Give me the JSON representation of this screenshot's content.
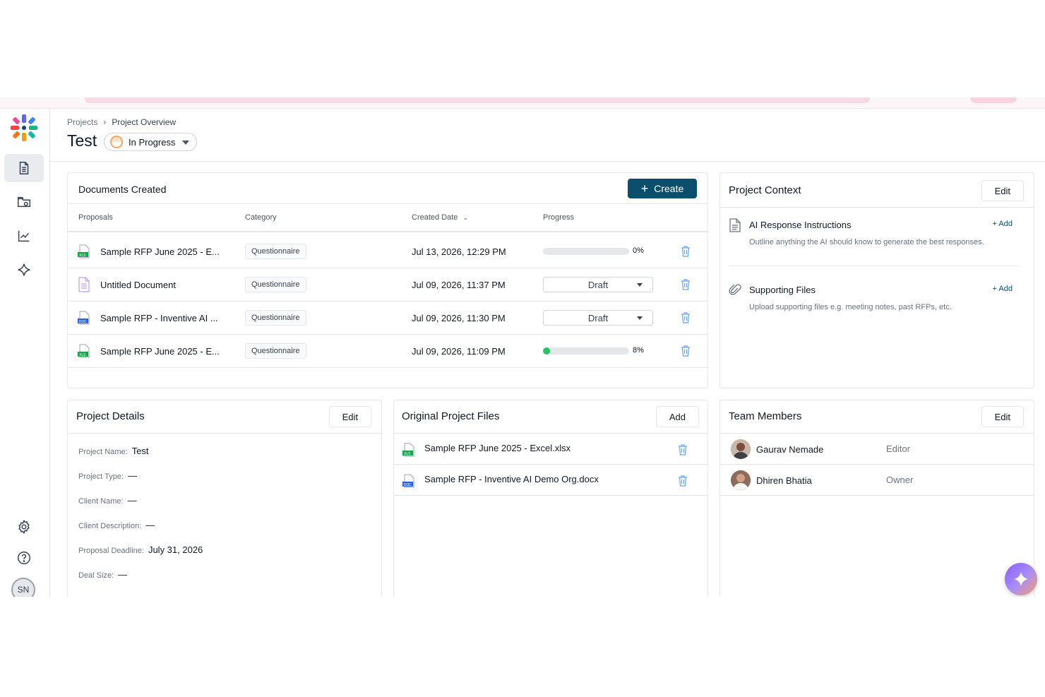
{
  "breadcrumb": {
    "root": "Projects",
    "current": "Project Overview"
  },
  "project": {
    "title": "Test",
    "status": "In Progress"
  },
  "documents": {
    "title": "Documents Created",
    "create_label": "Create",
    "columns": [
      "Proposals",
      "Category",
      "Created Date",
      "Progress"
    ],
    "rows": [
      {
        "name": "Sample RFP June 2025 - E...",
        "type": "xls",
        "category": "Questionnaire",
        "date": "Jul 13, 2026, 12:29 PM",
        "progress_kind": "bar",
        "progress": 0,
        "progress_label": "0%"
      },
      {
        "name": "Untitled Document",
        "type": "doc",
        "category": "Questionnaire",
        "date": "Jul 09, 2026, 11:37 PM",
        "progress_kind": "draft",
        "progress_label": "Draft"
      },
      {
        "name": "Sample RFP - Inventive AI ...",
        "type": "docx",
        "category": "Questionnaire",
        "date": "Jul 09, 2026, 11:30 PM",
        "progress_kind": "draft",
        "progress_label": "Draft"
      },
      {
        "name": "Sample RFP June 2025 - E...",
        "type": "xls",
        "category": "Questionnaire",
        "date": "Jul 09, 2026, 11:09 PM",
        "progress_kind": "bar",
        "progress": 8,
        "progress_label": "8%"
      }
    ]
  },
  "context": {
    "title": "Project Context",
    "edit_label": "Edit",
    "items": [
      {
        "title": "AI Response Instructions",
        "add_label": "+ Add",
        "desc": "Outline anything the AI should know to generate the best responses."
      },
      {
        "title": "Supporting Files",
        "add_label": "+ Add",
        "desc": "Upload supporting files e.g. meeting notes, past RFPs, etc."
      }
    ]
  },
  "details": {
    "title": "Project Details",
    "edit_label": "Edit",
    "fields": [
      {
        "label": "Project Name:",
        "value": "Test"
      },
      {
        "label": "Project Type:",
        "value": "—"
      },
      {
        "label": "Client Name:",
        "value": "—"
      },
      {
        "label": "Client Description:",
        "value": "—"
      },
      {
        "label": "Proposal Deadline:",
        "value": "July 31, 2026"
      },
      {
        "label": "Deal Size:",
        "value": "—"
      }
    ]
  },
  "project_files": {
    "title": "Original Project Files",
    "add_label": "Add",
    "files": [
      {
        "name": "Sample RFP June 2025 - Excel.xlsx",
        "type": "xls"
      },
      {
        "name": "Sample RFP - Inventive AI Demo Org.docx",
        "type": "docx"
      }
    ]
  },
  "team": {
    "title": "Team Members",
    "edit_label": "Edit",
    "members": [
      {
        "name": "Gaurav Nemade",
        "role": "Editor"
      },
      {
        "name": "Dhiren Bhatia",
        "role": "Owner"
      }
    ]
  },
  "user": {
    "initials": "SN"
  },
  "colors": {
    "primary": "#0b4f6c",
    "progress": "#22c55e",
    "status_ring": "#f4a56a"
  }
}
